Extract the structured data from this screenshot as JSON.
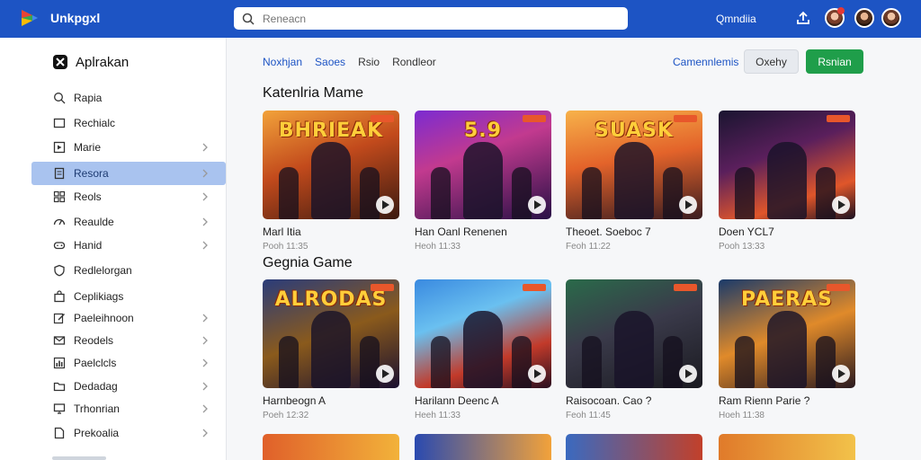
{
  "app": {
    "title": "Unkpgxl"
  },
  "search": {
    "placeholder": "Reneacn"
  },
  "topbar": {
    "link": "Qmndiia"
  },
  "sidebar": {
    "header": "Aplrakan",
    "items": [
      {
        "label": "Rapia",
        "icon": "search-icon",
        "chevron": false,
        "active": false
      },
      {
        "label": "Rechialc",
        "icon": "window-icon",
        "chevron": false,
        "active": false
      },
      {
        "label": "Marie",
        "icon": "play-square-icon",
        "chevron": true,
        "active": false
      },
      {
        "label": "Resora",
        "icon": "document-icon",
        "chevron": true,
        "active": true
      },
      {
        "label": "Reols",
        "icon": "grid-icon",
        "chevron": true,
        "active": false
      },
      {
        "label": "Reaulde",
        "icon": "gauge-icon",
        "chevron": true,
        "active": false
      },
      {
        "label": "Hanid",
        "icon": "controller-icon",
        "chevron": true,
        "active": false
      },
      {
        "label": "Redlelorgan",
        "icon": "shield-icon",
        "chevron": false,
        "active": false
      },
      {
        "label": "Ceplikiags",
        "icon": "bag-icon",
        "chevron": false,
        "active": false
      },
      {
        "label": "Paeleihnoon",
        "icon": "edit-icon",
        "chevron": true,
        "active": false
      },
      {
        "label": "Reodels",
        "icon": "mail-icon",
        "chevron": true,
        "active": false
      },
      {
        "label": "Paelclcls",
        "icon": "chart-icon",
        "chevron": true,
        "active": false
      },
      {
        "label": "Dedadag",
        "icon": "folder-icon",
        "chevron": true,
        "active": false
      },
      {
        "label": "Trhonrian",
        "icon": "monitor-icon",
        "chevron": true,
        "active": false
      },
      {
        "label": "Prekoalia",
        "icon": "file-icon",
        "chevron": true,
        "active": false
      }
    ]
  },
  "main": {
    "tabs": [
      {
        "label": "Noxhjan",
        "style": "link"
      },
      {
        "label": "Saoes",
        "style": "link"
      },
      {
        "label": "Rsio",
        "style": "plain"
      },
      {
        "label": "Rondleor",
        "style": "plain"
      }
    ],
    "action_link": "Camennlemis",
    "secondary_button": "Oxehy",
    "primary_button": "Rsnian",
    "sections": [
      {
        "title": "Katenlria Mame",
        "cards": [
          {
            "title": "Marl Itia",
            "meta": "Pooh 11:35",
            "art": "BHRIEAK"
          },
          {
            "title": "Han Oanl Renenen",
            "meta": "Heoh 11:33",
            "art": "5.9"
          },
          {
            "title": "Theoet. Soeboc 7",
            "meta": "Feoh 11:22",
            "art": "SUASK"
          },
          {
            "title": "Doen YCL7",
            "meta": "Pooh 13:33",
            "art": ""
          }
        ]
      },
      {
        "title": "Gegnia Game",
        "cards": [
          {
            "title": "Harnbeogn A",
            "meta": "Poeh 12:32",
            "art": "ALRODAS"
          },
          {
            "title": "Harilann Deenc A",
            "meta": "Heeh 11:33",
            "art": ""
          },
          {
            "title": "Raisocoan. Cao ?",
            "meta": "Feoh 11:45",
            "art": ""
          },
          {
            "title": "Ram Rienn Parie ?",
            "meta": "Hoeh 11:38",
            "art": "PAERAS"
          }
        ]
      }
    ]
  },
  "colors": {
    "topbar": "#1d54c4",
    "active_nav": "#a9c3ef",
    "primary": "#1f9e4a"
  }
}
